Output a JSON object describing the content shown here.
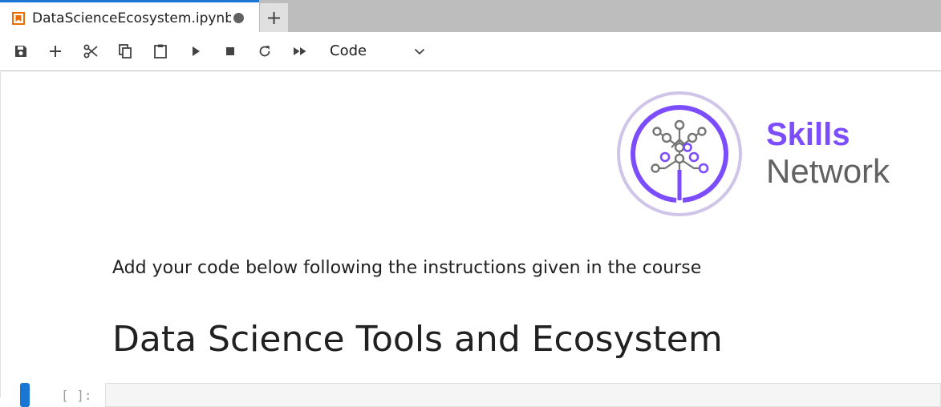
{
  "tab": {
    "title": "DataScienceEcosystem.ipynb",
    "add_label": "+"
  },
  "toolbar": {
    "buttons": [
      {
        "icon": "save-icon"
      },
      {
        "icon": "plus-icon"
      },
      {
        "icon": "scissors-icon"
      },
      {
        "icon": "copy-icon"
      },
      {
        "icon": "paste-icon"
      },
      {
        "icon": "run-icon"
      },
      {
        "icon": "stop-icon"
      },
      {
        "icon": "restart-icon"
      },
      {
        "icon": "fast-forward-icon"
      }
    ],
    "cell_type": "Code"
  },
  "notebook": {
    "brand": {
      "line1": "Skills",
      "line2": "Network",
      "primary_color": "#7c4dff",
      "secondary_color": "#616161"
    },
    "instruction": "Add your code below following the instructions given in the course",
    "heading": "Data Science Tools and Ecosystem",
    "prompt": "[ ]:"
  },
  "colors": {
    "accent": "#1976d2",
    "tab_bar": "#bdbdbd"
  }
}
